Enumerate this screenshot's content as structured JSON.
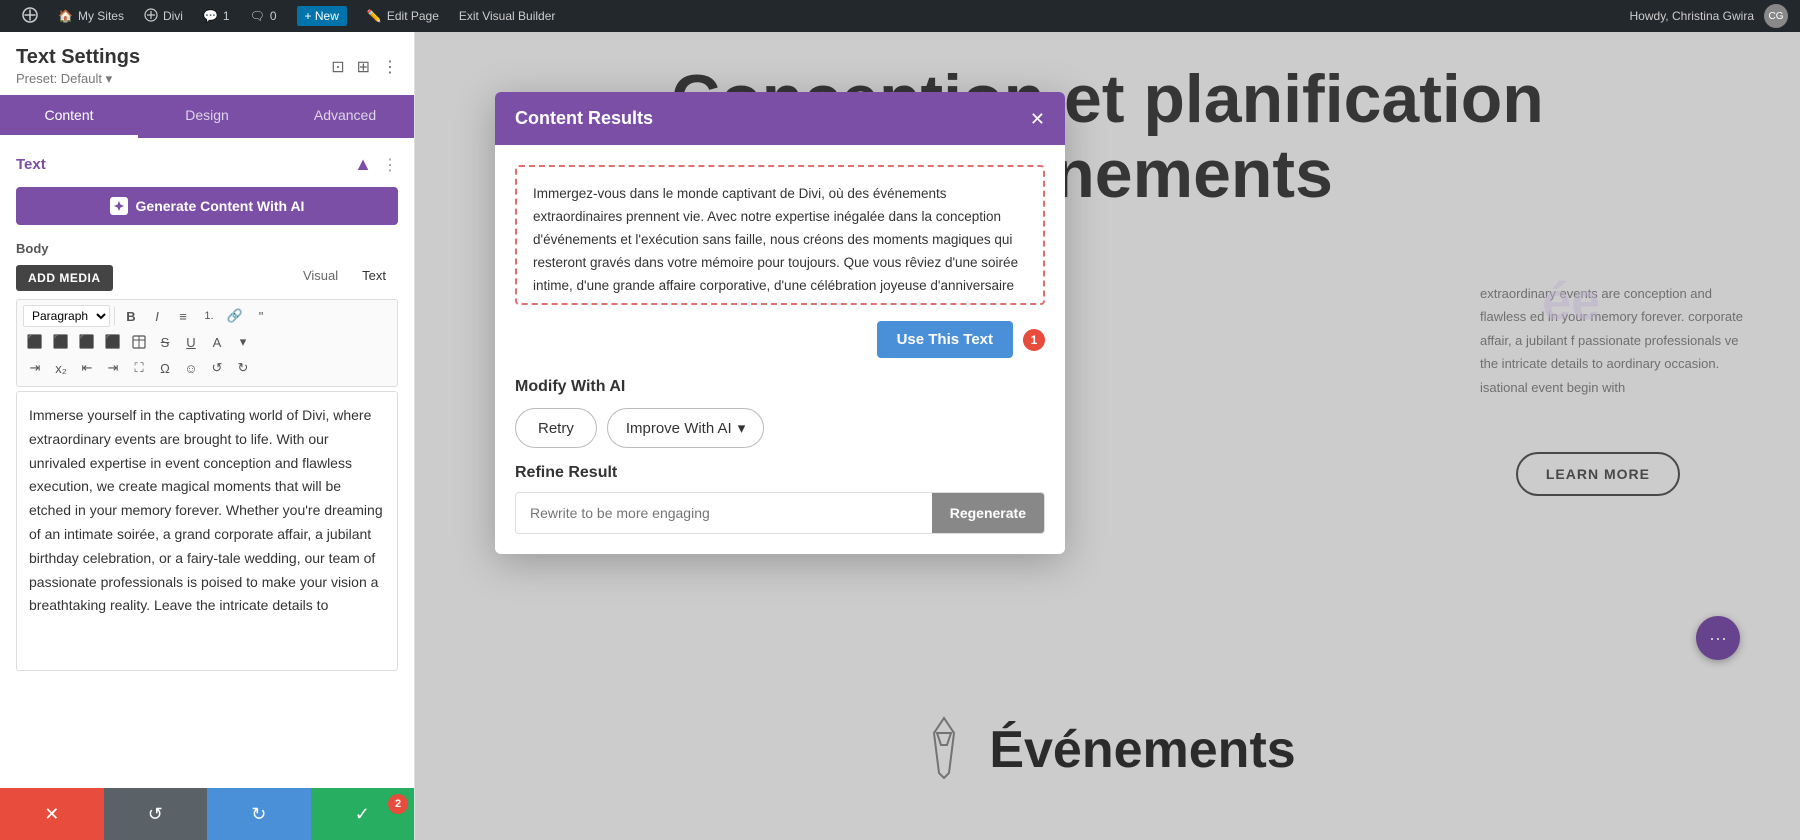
{
  "admin_bar": {
    "wp_icon": "⊞",
    "my_sites": "My Sites",
    "divi": "Divi",
    "comments_count": "1",
    "comments_icon": "💬",
    "new_label": "+ New",
    "edit_page": "Edit Page",
    "exit_builder": "Exit Visual Builder",
    "howdy": "Howdy, Christina Gwira"
  },
  "left_panel": {
    "title": "Text Settings",
    "preset": "Preset: Default",
    "tabs": [
      "Content",
      "Design",
      "Advanced"
    ],
    "active_tab": "Content",
    "section_title": "Text",
    "generate_btn": "Generate Content With AI",
    "body_label": "Body",
    "add_media": "ADD MEDIA",
    "editor_tabs": [
      "Visual",
      "Text"
    ],
    "paragraph_select": "Paragraph",
    "editor_text": "Immerse yourself in the captivating world of Divi, where extraordinary events are brought to life. With our unrivaled expertise in event conception and flawless execution, we create magical moments that will be etched in your memory forever. Whether you're dreaming of an intimate soirée, a grand corporate affair, a jubilant birthday celebration, or a fairy-tale wedding, our team of passionate professionals is poised to make your vision a breathtaking reality. Leave the intricate details to"
  },
  "bottom_bar": {
    "close_icon": "✕",
    "undo_icon": "↺",
    "redo_icon": "↻",
    "save_icon": "✓",
    "save_badge": "2"
  },
  "modal": {
    "title": "Content Results",
    "close_icon": "✕",
    "generated_text": "Immergez-vous dans le monde captivant de Divi, où des événements extraordinaires prennent vie. Avec notre expertise inégalée dans la conception d'événements et l'exécution sans faille, nous créons des moments magiques qui resteront gravés dans votre mémoire pour toujours. Que vous rêviez d'une soirée intime, d'une grande affaire corporative, d'une célébration joyeuse d'anniversaire ou d'un mariage de",
    "use_text_btn": "Use This Text",
    "use_text_badge": "1",
    "modify_label": "Modify With AI",
    "retry_btn": "Retry",
    "improve_btn": "Improve With AI",
    "improve_icon": "▾",
    "refine_label": "Refine Result",
    "refine_placeholder": "Rewrite to be more engaging",
    "regenerate_btn": "Regenerate"
  },
  "page": {
    "heading_line1": "Conception et planification",
    "heading_line2": "d'événements",
    "subtext_right": "extraordinary events are conception and flawless ed in your memory forever. corporate affair, a jubilant f passionate professionals ve the intricate details to aordinary occasion. isational event begin with",
    "learn_more": "LEARN MORE",
    "events_title": "Événements",
    "chat_icon": "···"
  }
}
